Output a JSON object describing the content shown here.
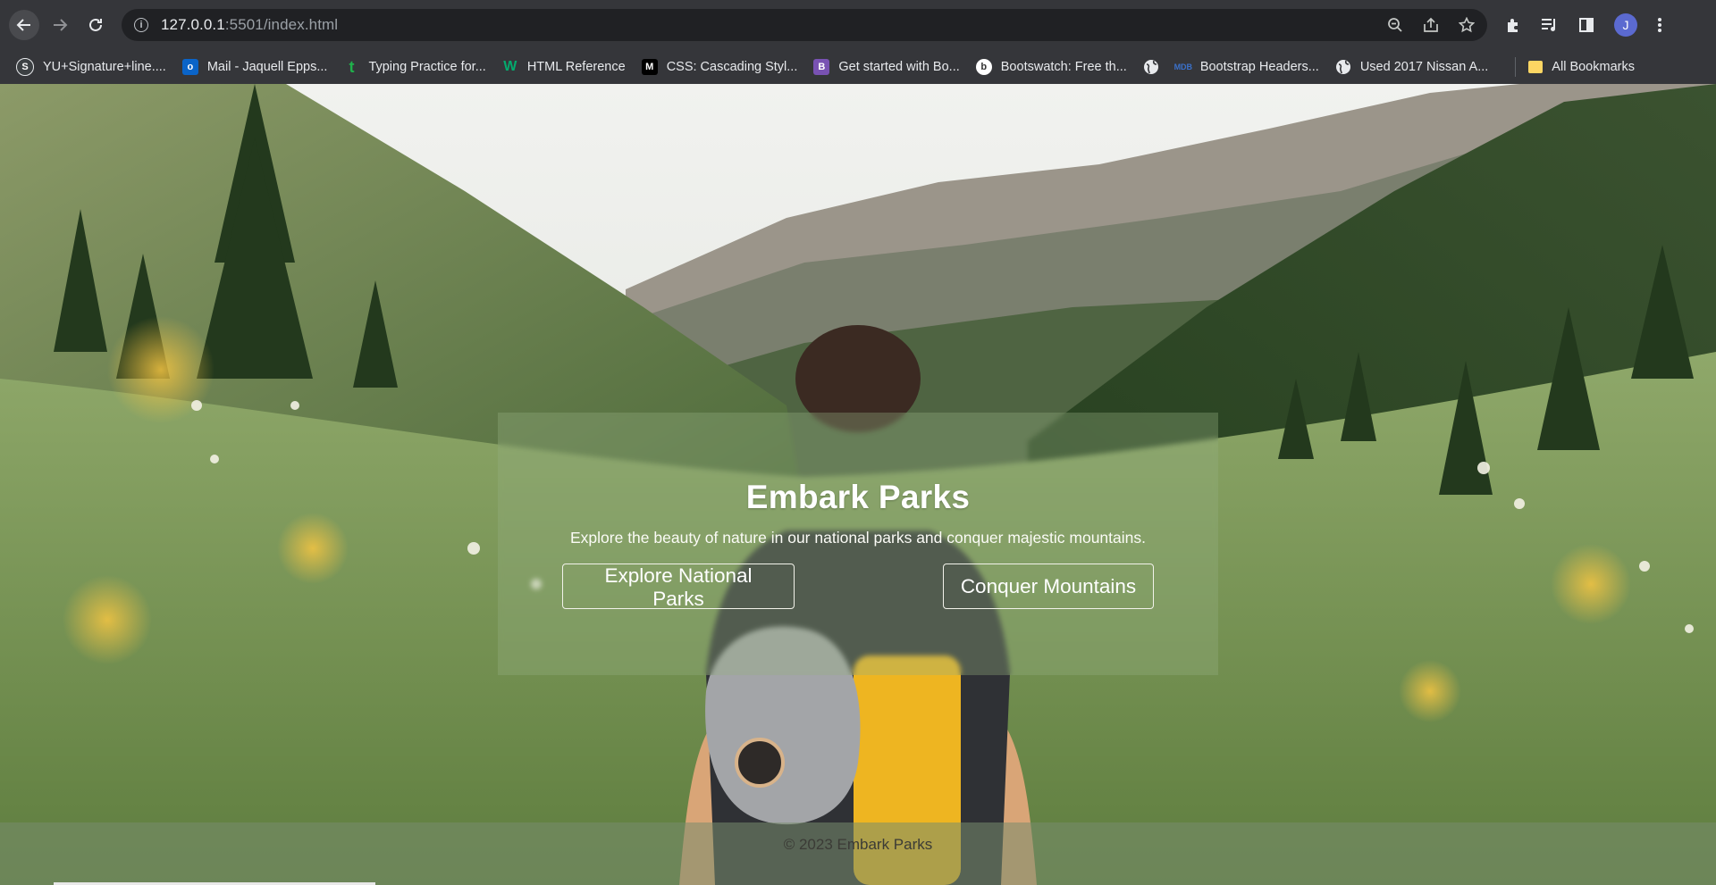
{
  "browser": {
    "url_host": "127.0.0.1",
    "url_rest": ":5501/index.html",
    "avatar_letter": "J",
    "bookmarks": [
      {
        "label": "YU+Signature+line....",
        "icon": "signature-icon",
        "color": "#3c4043"
      },
      {
        "label": "Mail - Jaquell Epps...",
        "icon": "outlook-icon",
        "color": "#0a64c8"
      },
      {
        "label": "Typing Practice for...",
        "icon": "typing-icon",
        "color": "#1fb14b"
      },
      {
        "label": "HTML Reference",
        "icon": "w3-icon",
        "color": "#04aa6d"
      },
      {
        "label": "CSS: Cascading Styl...",
        "icon": "mdn-icon",
        "color": "#000000"
      },
      {
        "label": "Get started with Bo...",
        "icon": "bootstrap-icon",
        "color": "#7952b3"
      },
      {
        "label": "Bootswatch: Free th...",
        "icon": "bootswatch-icon",
        "color": "#2a2a2a"
      },
      {
        "label": "",
        "icon": "globe-icon",
        "color": "#5f6368"
      },
      {
        "label": "Bootstrap Headers...",
        "icon": "mdb-icon",
        "color": "#3b71ca"
      },
      {
        "label": "Used 2017 Nissan A...",
        "icon": "globe-icon",
        "color": "#5f6368"
      }
    ],
    "all_bookmarks": "All Bookmarks"
  },
  "hero": {
    "title": "Embark Parks",
    "subtitle": "Explore the beauty of nature in our national parks and conquer majestic mountains.",
    "btn_parks": "Explore National Parks",
    "btn_mountains": "Conquer Mountains"
  },
  "footer": {
    "text": "© 2023 Embark Parks"
  }
}
